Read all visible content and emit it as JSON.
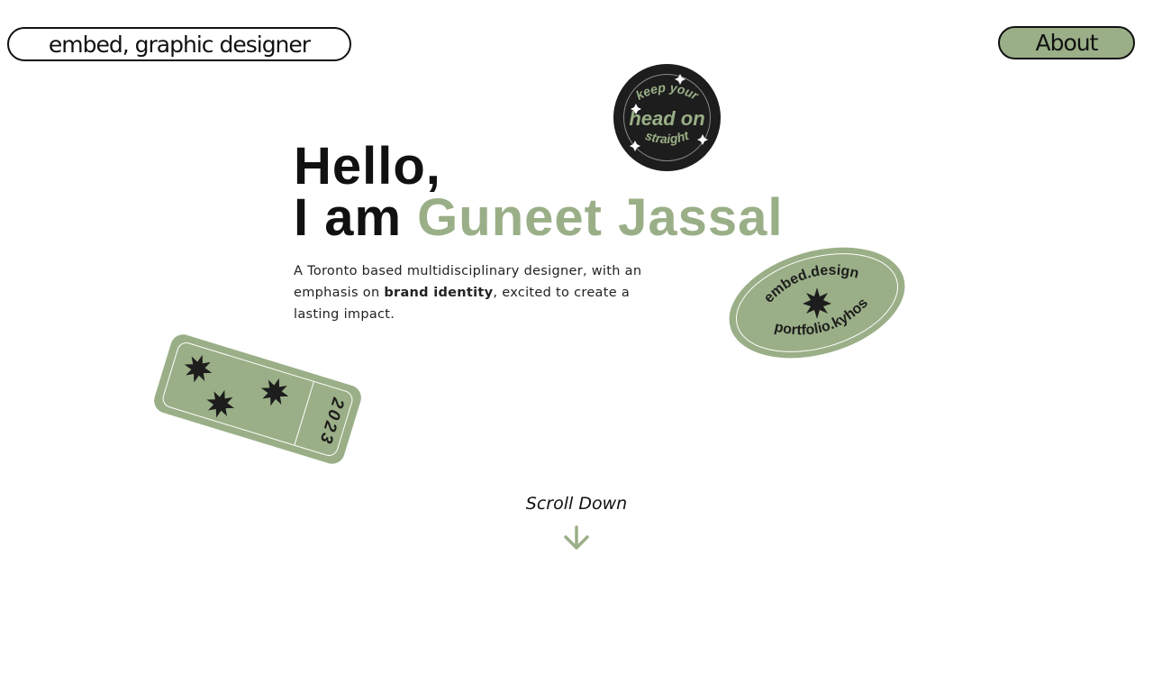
{
  "header": {
    "title_pill": "embed, graphic designer",
    "about_label": "About"
  },
  "hero": {
    "line1": "Hello,",
    "line2_prefix": "I am ",
    "name": "Guneet Jassal"
  },
  "intro": {
    "part1": "A Toronto based multidisciplinary designer, with an emphasis on ",
    "emphasis": "brand identity",
    "part2": ", excited to create a lasting impact."
  },
  "stickers": {
    "round_text": "keep your head on straight",
    "oval_text_top": "embed.design",
    "oval_text_bottom": "portfolio.kyhos",
    "ticket_year": "2023"
  },
  "scroll": {
    "label": "Scroll Down"
  },
  "colors": {
    "accent": "#9aaf87",
    "dark": "#1d1d1d",
    "text": "#111111"
  }
}
